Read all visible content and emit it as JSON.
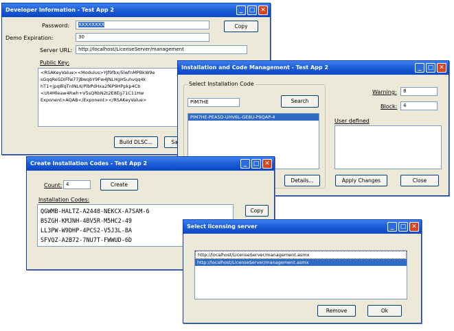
{
  "dev_info": {
    "title": "Developer Information - Test App 2",
    "password_label": "Password:",
    "password_value": "XXXXXXXX",
    "demo_expiration_label": "Demo Expiration:",
    "demo_expiration_value": "30",
    "server_url_label": "Server URL:",
    "server_url_value": "http://localhost/LicenseServer/management",
    "public_key_label": "Public Key:",
    "public_key_lines": [
      "<RSAKeyValue><Modulus>YJf9fbx/5lwfnMPBkW9e",
      "sGqqReSDIFfw77jBwqbY9Fw4JNLHgHSuhvqq4k",
      "hT1+jpq8lqTnlNL6/PlbPdHxa2f6P9HPpkp4Cb",
      "<Ut4Mleaw4Rwh+V5sQRbN2t2E8Eg71C11Hw",
      "Exponent>AQAB</Exponent></RSAKeyValue>"
    ],
    "copy_label": "Copy",
    "build_label": "Build DLSC...",
    "save_label": "Sa"
  },
  "install_mgmt": {
    "title": "Installation and Code Management - Test App 2",
    "select_code_label": "Select Installation Code",
    "search_value": "PIM7HE",
    "search_label": "Search",
    "selected_code": "PIM7HE-PEA5D-UHV6L-GE8U-P9QAP-4",
    "details_label": "Details...",
    "warning_label": "Warning:",
    "warning_value": "8",
    "block_label": "Block:",
    "block_value": "4",
    "user_defined_label": "User defined",
    "apply_label": "Apply Changes",
    "close_label": "Close"
  },
  "create_codes": {
    "title": "Create Installation Codes - Test App 2",
    "count_label": "Count:",
    "count_value": "4",
    "create_label": "Create",
    "codes_label": "Installation Codes:",
    "codes": [
      "QGWMB-HALTZ-A2448-NEKCX-A7SAM-6",
      "BSZGH-KMJNH-4BV5R-M5HC2-49",
      "LL3PW-W9DHP-4PCS2-V5J3L-BA",
      "SFVQZ-A2B72-7NU7T-FWWUD-6D"
    ],
    "copy_label": "Copy"
  },
  "licensing_server": {
    "title": "Select licensing server",
    "servers": [
      "http://localhost/LicenseServer/management.asmx",
      "http://localhost/LicenseServer/management.asmx"
    ],
    "remove_label": "Remove",
    "ok_label": "Ok"
  },
  "titlebar_icons": [
    "minimize-icon",
    "maximize-icon",
    "close-icon"
  ]
}
